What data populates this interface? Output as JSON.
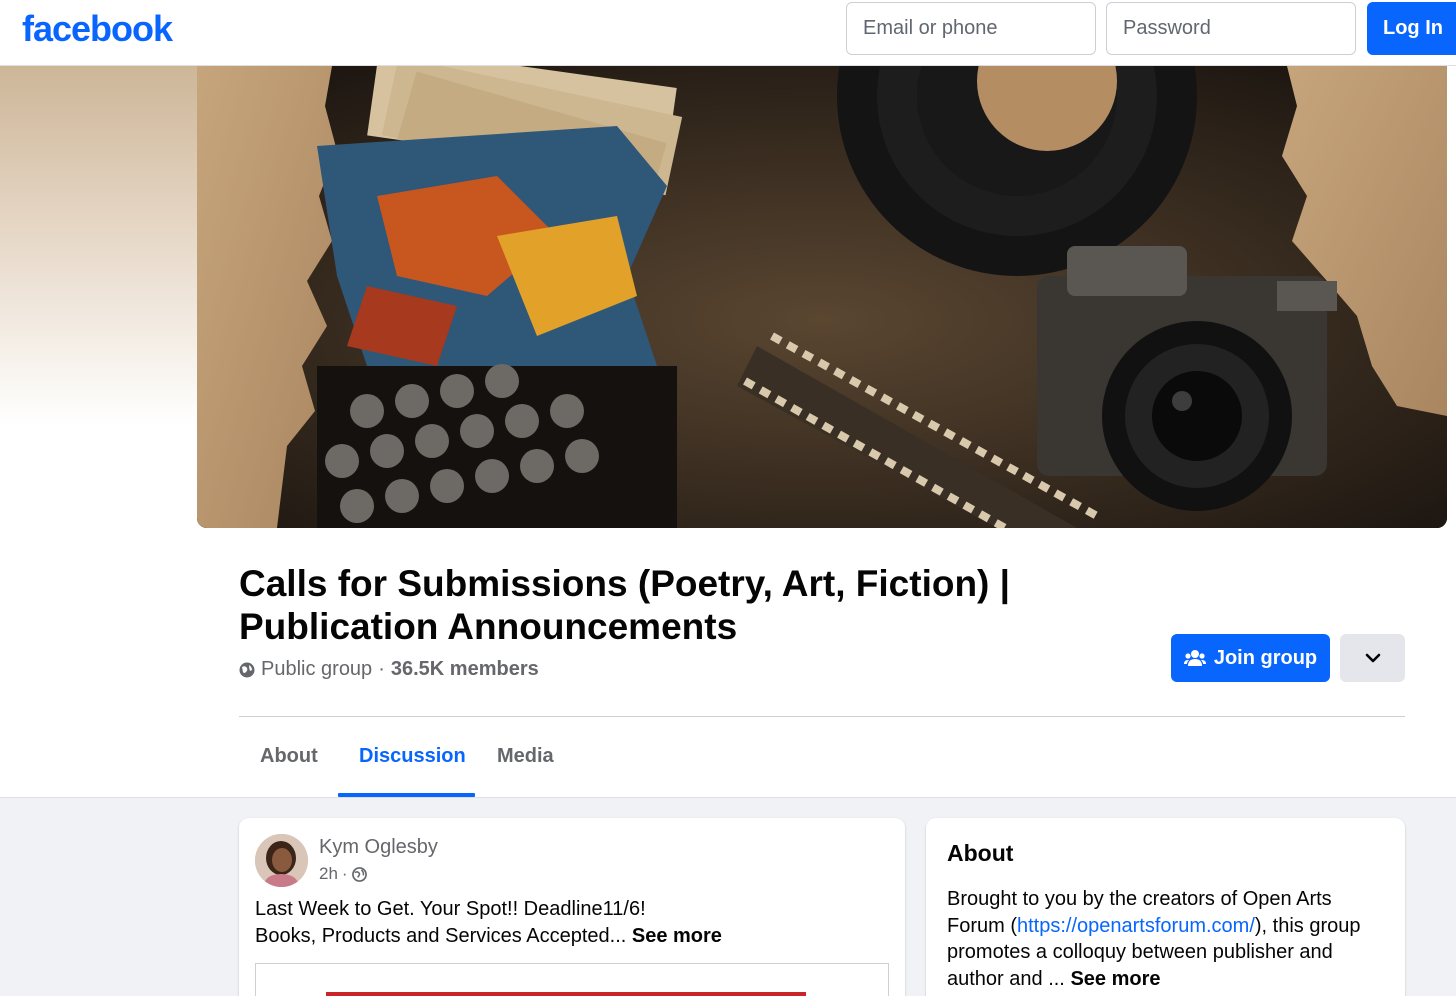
{
  "topbar": {
    "logo": "facebook",
    "email_placeholder": "Email or phone",
    "password_placeholder": "Password",
    "login_label": "Log In"
  },
  "group": {
    "title": "Calls for Submissions (Poetry, Art, Fiction) | Publication Announcements",
    "privacy": "Public group",
    "separator": "·",
    "members": "36.5K members",
    "join_label": "Join group"
  },
  "tabs": [
    {
      "label": "About"
    },
    {
      "label": "Discussion",
      "active": true
    },
    {
      "label": "Media"
    }
  ],
  "post": {
    "author": "Kym Oglesby",
    "time": "2h",
    "time_separator": "·",
    "line1": "Last Week to Get. Your Spot!! Deadline11/6!",
    "line2": "Books, Products and Services Accepted...",
    "see_more": "See more"
  },
  "about": {
    "title": "About",
    "text_before_link": "Brought to you by the creators of Open Arts Forum (",
    "link": "https://openartsforum.com/",
    "text_after_link": "), this group promotes a colloquy between publisher and author and ...",
    "see_more": "See more"
  },
  "colors": {
    "brand": "#0866ff",
    "secondary_text": "#65676b",
    "feed_background": "#f0f2f5"
  },
  "icons": [
    "globe-icon",
    "join-group-icon",
    "chevron-down-icon"
  ]
}
